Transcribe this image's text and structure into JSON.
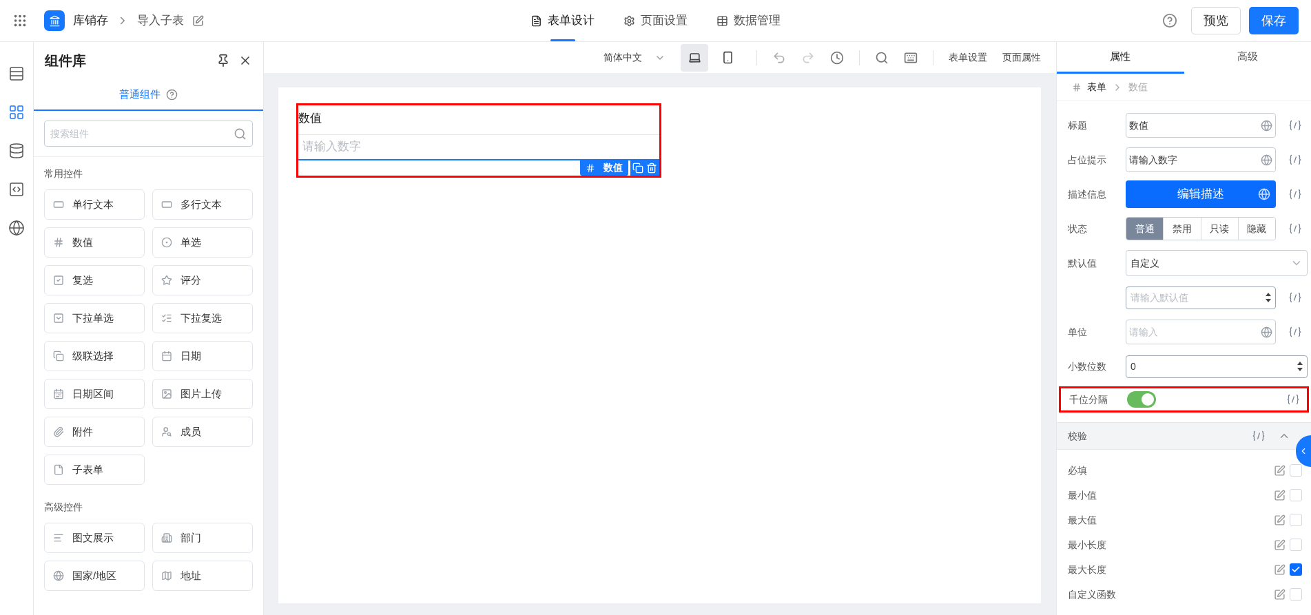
{
  "app_bar": {
    "app_name": "库销存",
    "page_name": "导入子表",
    "tabs": [
      {
        "label": "表单设计",
        "kind": "form",
        "selected": true
      },
      {
        "label": "页面设置",
        "kind": "settings",
        "selected": false
      },
      {
        "label": "数据管理",
        "kind": "table",
        "selected": false
      }
    ],
    "buttons": [
      {
        "label": "预览",
        "kind": "secondary"
      },
      {
        "label": "保存",
        "kind": "primary"
      }
    ]
  },
  "rail": [
    {
      "kind": "outline",
      "selected": false
    },
    {
      "kind": "components",
      "selected": true
    },
    {
      "kind": "data",
      "selected": false
    },
    {
      "kind": "script",
      "selected": false
    },
    {
      "kind": "i18n",
      "selected": false
    }
  ],
  "component_panel": {
    "title": "组件库",
    "tabs": [
      {
        "label": "普通组件",
        "selected": true
      }
    ],
    "search": {
      "placeholder": "搜索组件"
    },
    "groups": [
      {
        "title": "常用控件",
        "items": [
          {
            "label": "单行文本",
            "kind": "text"
          },
          {
            "label": "多行文本",
            "kind": "textarea"
          },
          {
            "label": "数值",
            "kind": "number"
          },
          {
            "label": "单选",
            "kind": "radio"
          },
          {
            "label": "复选",
            "kind": "checkbox"
          },
          {
            "label": "评分",
            "kind": "rating"
          },
          {
            "label": "下拉单选",
            "kind": "select"
          },
          {
            "label": "下拉复选",
            "kind": "multiselect"
          },
          {
            "label": "级联选择",
            "kind": "cascade"
          },
          {
            "label": "日期",
            "kind": "date"
          },
          {
            "label": "日期区间",
            "kind": "daterange"
          },
          {
            "label": "图片上传",
            "kind": "image"
          },
          {
            "label": "附件",
            "kind": "attachment"
          },
          {
            "label": "成员",
            "kind": "member"
          },
          {
            "label": "子表单",
            "kind": "subform"
          }
        ]
      },
      {
        "title": "高级控件",
        "items": [
          {
            "label": "图文展示",
            "kind": "richtext"
          },
          {
            "label": "部门",
            "kind": "department"
          },
          {
            "label": "国家/地区",
            "kind": "country"
          },
          {
            "label": "地址",
            "kind": "address"
          }
        ]
      }
    ]
  },
  "toolbar": {
    "language": "简体中文",
    "devices": [
      {
        "kind": "desktop",
        "selected": true
      },
      {
        "kind": "mobile",
        "selected": false
      }
    ],
    "links": [
      "表单设置",
      "页面属性"
    ]
  },
  "canvas": {
    "field": {
      "label": "数值",
      "placeholder": "请输入数字",
      "tag": "数值",
      "selected": true,
      "highlighted": true
    }
  },
  "properties": {
    "tabs": [
      {
        "label": "属性",
        "selected": true
      },
      {
        "label": "高级",
        "selected": false
      }
    ],
    "breadcrumb": [
      "表单",
      "数值"
    ],
    "rows": [
      {
        "kind": "text",
        "label": "标题",
        "value": "数值",
        "expression": true
      },
      {
        "kind": "text",
        "label": "占位提示",
        "value": "请输入数字",
        "expression": true
      },
      {
        "kind": "button",
        "label": "描述信息",
        "button": "编辑描述",
        "expression": true
      },
      {
        "kind": "segmented",
        "label": "状态",
        "options": [
          {
            "label": "普通",
            "selected": true
          },
          {
            "label": "禁用",
            "selected": false
          },
          {
            "label": "只读",
            "selected": false
          },
          {
            "label": "隐藏",
            "selected": false
          }
        ],
        "expression": true
      },
      {
        "kind": "select",
        "label": "默认值",
        "value": "自定义",
        "expression": false
      },
      {
        "kind": "number",
        "placeholder": "请输入默认值",
        "expression": true
      },
      {
        "kind": "text",
        "label": "单位",
        "placeholder": "请输入",
        "expression": true
      },
      {
        "kind": "number",
        "label": "小数位数",
        "value": "0",
        "expression": false
      },
      {
        "kind": "switch",
        "label": "千位分隔",
        "on": true,
        "highlighted": true,
        "expression": true
      }
    ],
    "validation": {
      "title": "校验",
      "expanded": true,
      "rules": [
        {
          "label": "必填",
          "checked": false
        },
        {
          "label": "最小值",
          "checked": false
        },
        {
          "label": "最大值",
          "checked": false
        },
        {
          "label": "最小长度",
          "checked": false
        },
        {
          "label": "最大长度",
          "checked": true
        },
        {
          "label": "自定义函数",
          "checked": false
        }
      ]
    }
  }
}
